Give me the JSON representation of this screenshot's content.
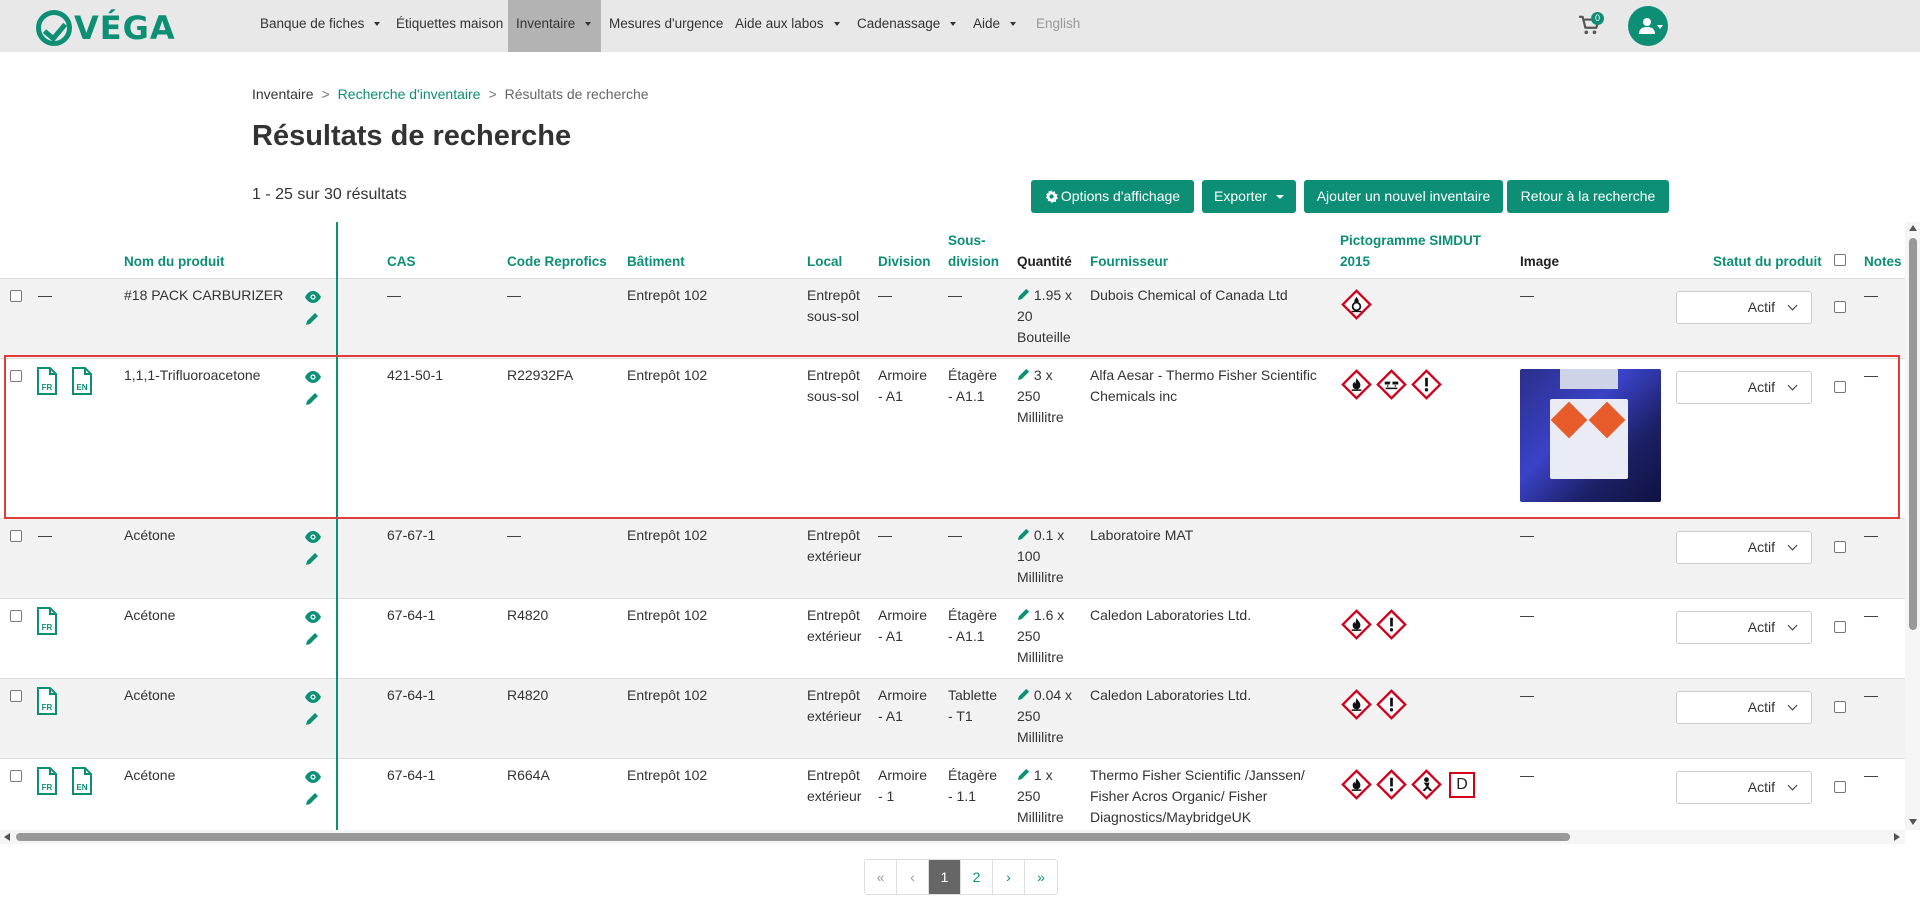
{
  "brand": "VÉGA",
  "nav": {
    "items": [
      {
        "label": "Banque de fiches"
      },
      {
        "label": "Étiquettes maison"
      },
      {
        "label": "Inventaire"
      },
      {
        "label": "Mesures d'urgence"
      },
      {
        "label": "Aide aux labos"
      },
      {
        "label": "Cadenassage"
      },
      {
        "label": "Aide"
      },
      {
        "label": "English"
      }
    ],
    "cart_count": "0"
  },
  "breadcrumb": [
    "Inventaire",
    "Recherche d'inventaire",
    "Résultats de recherche"
  ],
  "page_title": "Résultats de recherche",
  "results_count": "1 - 25 sur 30 résultats",
  "buttons": {
    "display_options": "Options d'affichage",
    "export": "Exporter",
    "add_inventory": "Ajouter un nouvel inventaire",
    "back_to_search": "Retour à la recherche"
  },
  "columns": {
    "product_name": "Nom du produit",
    "cas": "CAS",
    "reprofics": "Code Reprofics",
    "building": "Bâtiment",
    "local": "Local",
    "division": "Division",
    "subdivision_1": "Sous-",
    "subdivision_2": "division",
    "quantity": "Quantité",
    "supplier": "Fournisseur",
    "pictogram_1": "Pictogramme SIMDUT",
    "pictogram_2": "2015",
    "image": "Image",
    "status": "Statut du produit",
    "notes": "Notes"
  },
  "rows": [
    {
      "sheet": "—",
      "name": "#18 PACK CARBURIZER",
      "cas": "—",
      "reprofics": "—",
      "building": "Entrepôt 102",
      "local": [
        "Entrepôt",
        "sous-sol"
      ],
      "division": [
        "—"
      ],
      "subdivision": [
        "—"
      ],
      "quantity": [
        "1.95 x",
        "20",
        "Bouteille"
      ],
      "supplier": [
        "Dubois Chemical of Canada Ltd"
      ],
      "image": "—",
      "status": "Actif",
      "notes": "—"
    },
    {
      "sheet_fr": "FR",
      "sheet_en": "EN",
      "name": "1,1,1-Trifluoroacetone",
      "cas": "421-50-1",
      "reprofics": "R22932FA",
      "building": "Entrepôt 102",
      "local": [
        "Entrepôt",
        "sous-sol"
      ],
      "division": [
        "Armoire",
        "- A1"
      ],
      "subdivision": [
        "Étagère",
        "- A1.1"
      ],
      "quantity": [
        "3 x",
        "250",
        "Millilitre"
      ],
      "supplier": [
        "Alfa Aesar - Thermo Fisher Scientific",
        "Chemicals inc"
      ],
      "status": "Actif",
      "notes": "—"
    },
    {
      "sheet": "—",
      "name": "Acétone",
      "cas": "67-67-1",
      "reprofics": "—",
      "building": "Entrepôt 102",
      "local": [
        "Entrepôt",
        "extérieur"
      ],
      "division": [
        "—"
      ],
      "subdivision": [
        "—"
      ],
      "quantity": [
        "0.1 x",
        "100",
        "Millilitre"
      ],
      "supplier": [
        "Laboratoire MAT"
      ],
      "image": "—",
      "status": "Actif",
      "notes": "—"
    },
    {
      "sheet_fr": "FR",
      "name": "Acétone",
      "cas": "67-64-1",
      "reprofics": "R4820",
      "building": "Entrepôt 102",
      "local": [
        "Entrepôt",
        "extérieur"
      ],
      "division": [
        "Armoire",
        "- A1"
      ],
      "subdivision": [
        "Étagère",
        "- A1.1"
      ],
      "quantity": [
        "1.6 x",
        "250",
        "Millilitre"
      ],
      "supplier": [
        "Caledon Laboratories Ltd."
      ],
      "image": "—",
      "status": "Actif",
      "notes": "—"
    },
    {
      "sheet_fr": "FR",
      "name": "Acétone",
      "cas": "67-64-1",
      "reprofics": "R4820",
      "building": "Entrepôt 102",
      "local": [
        "Entrepôt",
        "extérieur"
      ],
      "division": [
        "Armoire",
        "- A1"
      ],
      "subdivision": [
        "Tablette",
        "- T1"
      ],
      "quantity": [
        "0.04 x",
        "250",
        "Millilitre"
      ],
      "supplier": [
        "Caledon Laboratories Ltd."
      ],
      "image": "—",
      "status": "Actif",
      "notes": "—"
    },
    {
      "sheet_fr": "FR",
      "sheet_en": "EN",
      "name": "Acétone",
      "cas": "67-64-1",
      "reprofics": "R664A",
      "building": "Entrepôt 102",
      "local": [
        "Entrepôt",
        "extérieur"
      ],
      "division": [
        "Armoire",
        "- 1"
      ],
      "subdivision": [
        "Étagère",
        "- 1.1"
      ],
      "quantity": [
        "1 x",
        "250",
        "Millilitre"
      ],
      "supplier": [
        "Thermo Fisher Scientific /Janssen/",
        "Fisher Acros Organic/ Fisher",
        "Diagnostics/MaybridgeUK"
      ],
      "d_label": "D",
      "image": "—",
      "status": "Actif",
      "notes": "—"
    }
  ],
  "pagination": [
    "«",
    "‹",
    "1",
    "2",
    "›",
    "»"
  ],
  "colors": {
    "accent": "#0d8f76",
    "hazard_red": "#d0021b",
    "highlight_red": "#e03c3c"
  }
}
